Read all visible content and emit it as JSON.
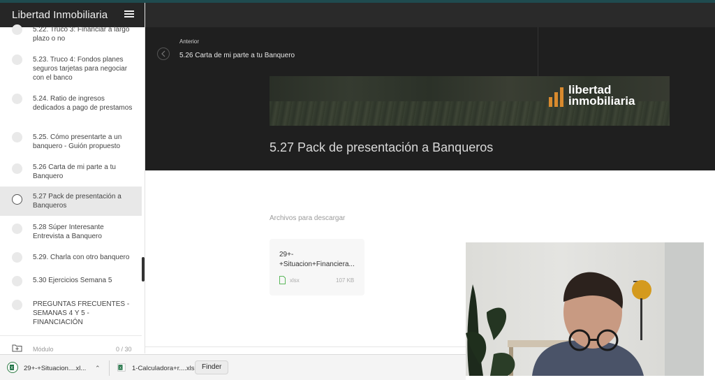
{
  "app": {
    "brand": "Libertad Inmobiliaria"
  },
  "sidebar": {
    "lessons": [
      {
        "title": "5.22. Truco 3: Financiar a largo plazo o no",
        "active": false
      },
      {
        "title": "5.23. Truco 4: Fondos planes seguros tarjetas para negociar con el banco",
        "active": false
      },
      {
        "title": "5.24. Ratio de ingresos dedicados a pago de prestamos",
        "active": false
      },
      {
        "title": "5.25. Cómo presentarte a un banquero - Guión propuesto",
        "active": false
      },
      {
        "title": "5.26 Carta de mi parte a tu Banquero",
        "active": false
      },
      {
        "title": "5.27 Pack de presentación a Banqueros",
        "active": true
      },
      {
        "title": "5.28 Súper Interesante Entrevista a Banquero",
        "active": false
      },
      {
        "title": "5.29. Charla con otro banquero",
        "active": false
      },
      {
        "title": "5.30 Ejercicios Semana 5",
        "active": false
      },
      {
        "title": "PREGUNTAS FRECUENTES - SEMANAS 4 Y 5 - FINANCIACIÓN",
        "active": false
      }
    ],
    "footer": {
      "label": "Módulo",
      "count": "0 / 30"
    }
  },
  "navigation": {
    "previous_label": "Anterior",
    "previous_title": "5.26 Carta de mi parte a tu Banquero"
  },
  "banner": {
    "logo_line1": "libertad",
    "logo_line2": "inmobiliaria",
    "accent_color": "#d88a2e"
  },
  "lesson": {
    "title": "5.27 Pack de presentación a Banqueros"
  },
  "downloads_section": {
    "label": "Archivos para descargar",
    "files": [
      {
        "name": "29+-+Situacion+Financiera...",
        "type": "xlsx",
        "size": "107 KB"
      }
    ]
  },
  "download_bar": {
    "items": [
      {
        "name": "29+-+Situacion....xl...",
        "icon": "excel-icon"
      },
      {
        "name": "1-Calculadora+r....xls",
        "icon": "excel-icon"
      }
    ],
    "tooltip": "Finder"
  }
}
